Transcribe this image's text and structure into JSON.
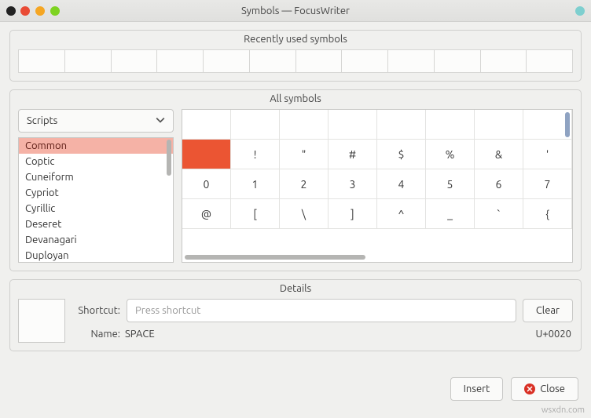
{
  "window": {
    "title": "Symbols — FocusWriter"
  },
  "recent": {
    "title": "Recently used symbols",
    "cells": [
      "",
      "",
      "",
      "",
      "",
      "",
      "",
      "",
      "",
      "",
      "",
      ""
    ]
  },
  "all": {
    "title": "All symbols",
    "filter_label": "Scripts",
    "scripts": [
      "Common",
      "Coptic",
      "Cuneiform",
      "Cypriot",
      "Cyrillic",
      "Deseret",
      "Devanagari",
      "Duployan"
    ],
    "selected_script": "Common",
    "grid": [
      [
        "",
        "",
        "",
        "",
        "",
        "",
        "",
        ""
      ],
      [
        "",
        "!",
        "\"",
        "#",
        "$",
        "%",
        "&",
        "'"
      ],
      [
        "0",
        "1",
        "2",
        "3",
        "4",
        "5",
        "6",
        "7"
      ],
      [
        "@",
        "[",
        "\\",
        "]",
        "^",
        "_",
        "`",
        "{"
      ]
    ],
    "selected_row": 1,
    "selected_col": 0
  },
  "details": {
    "title": "Details",
    "shortcut_label": "Shortcut:",
    "shortcut_placeholder": "Press shortcut",
    "clear_label": "Clear",
    "name_label": "Name:",
    "name_value": "SPACE",
    "codepoint": "U+0020"
  },
  "buttons": {
    "insert": "Insert",
    "close": "Close"
  },
  "watermark": "wsxdn.com"
}
